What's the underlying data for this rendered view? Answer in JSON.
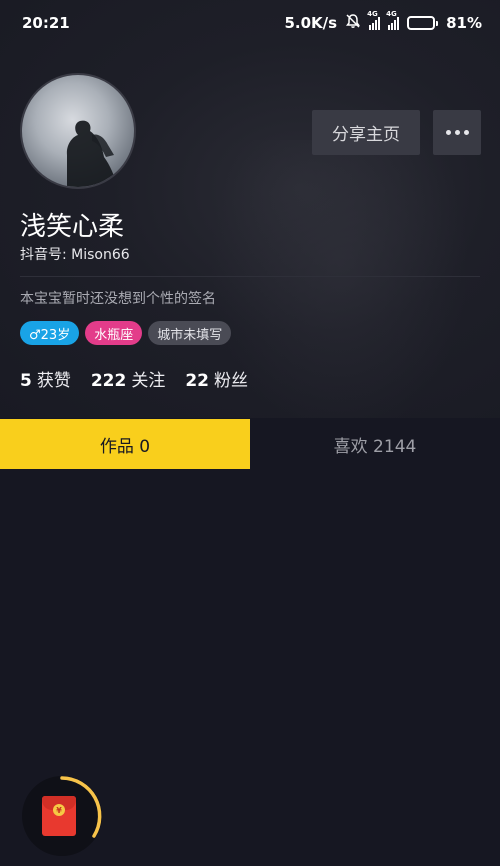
{
  "status_bar": {
    "time": "20:21",
    "speed": "5.0K/s",
    "network_1": "4G",
    "network_2": "4G",
    "battery": "81%",
    "battery_level": 0.81
  },
  "profile": {
    "nickname": "浅笑心柔",
    "douyin_id": "抖音号: Mison66",
    "bio": "本宝宝暂时还没想到个性的签名",
    "share_button": "分享主页",
    "tags": {
      "gender": "♂23岁",
      "zodiac": "水瓶座",
      "city": "城市未填写"
    },
    "stats": {
      "likes_count": "5",
      "likes_label": "获赞",
      "following_count": "222",
      "following_label": "关注",
      "followers_count": "22",
      "followers_label": "粉丝"
    }
  },
  "tabs": {
    "works": "作品 0",
    "likes": "喜欢 2144"
  },
  "red_packet": {
    "symbol": "¥"
  },
  "colors": {
    "accent_yellow": "#f9cf1c",
    "gender_blue": "#19a3e6",
    "zodiac_pink": "#e33c8a",
    "background": "#161722"
  },
  "icons": {
    "mute": "bell-mute-icon",
    "more": "more-dots-icon",
    "red_packet": "red-packet-icon"
  }
}
